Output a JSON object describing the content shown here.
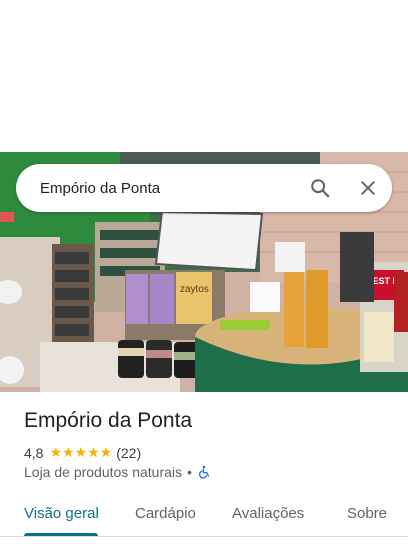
{
  "search": {
    "query": "Empório da Ponta"
  },
  "place": {
    "name": "Empório da Ponta",
    "rating": "4,8",
    "stars": "★★★★★",
    "review_count": "(22)",
    "category": "Loja de produtos naturais",
    "separator": "•"
  },
  "tabs": [
    {
      "label": "Visão geral",
      "active": true
    },
    {
      "label": "Cardápio"
    },
    {
      "label": "Avaliações"
    },
    {
      "label": "Sobre"
    }
  ],
  "photo": {
    "product_labels": [
      "zaytos",
      "BEST DIET",
      "DIET"
    ]
  },
  "colors": {
    "accent": "#0b7285",
    "star": "#f4b400",
    "wall_green": "#2e8b3e"
  }
}
